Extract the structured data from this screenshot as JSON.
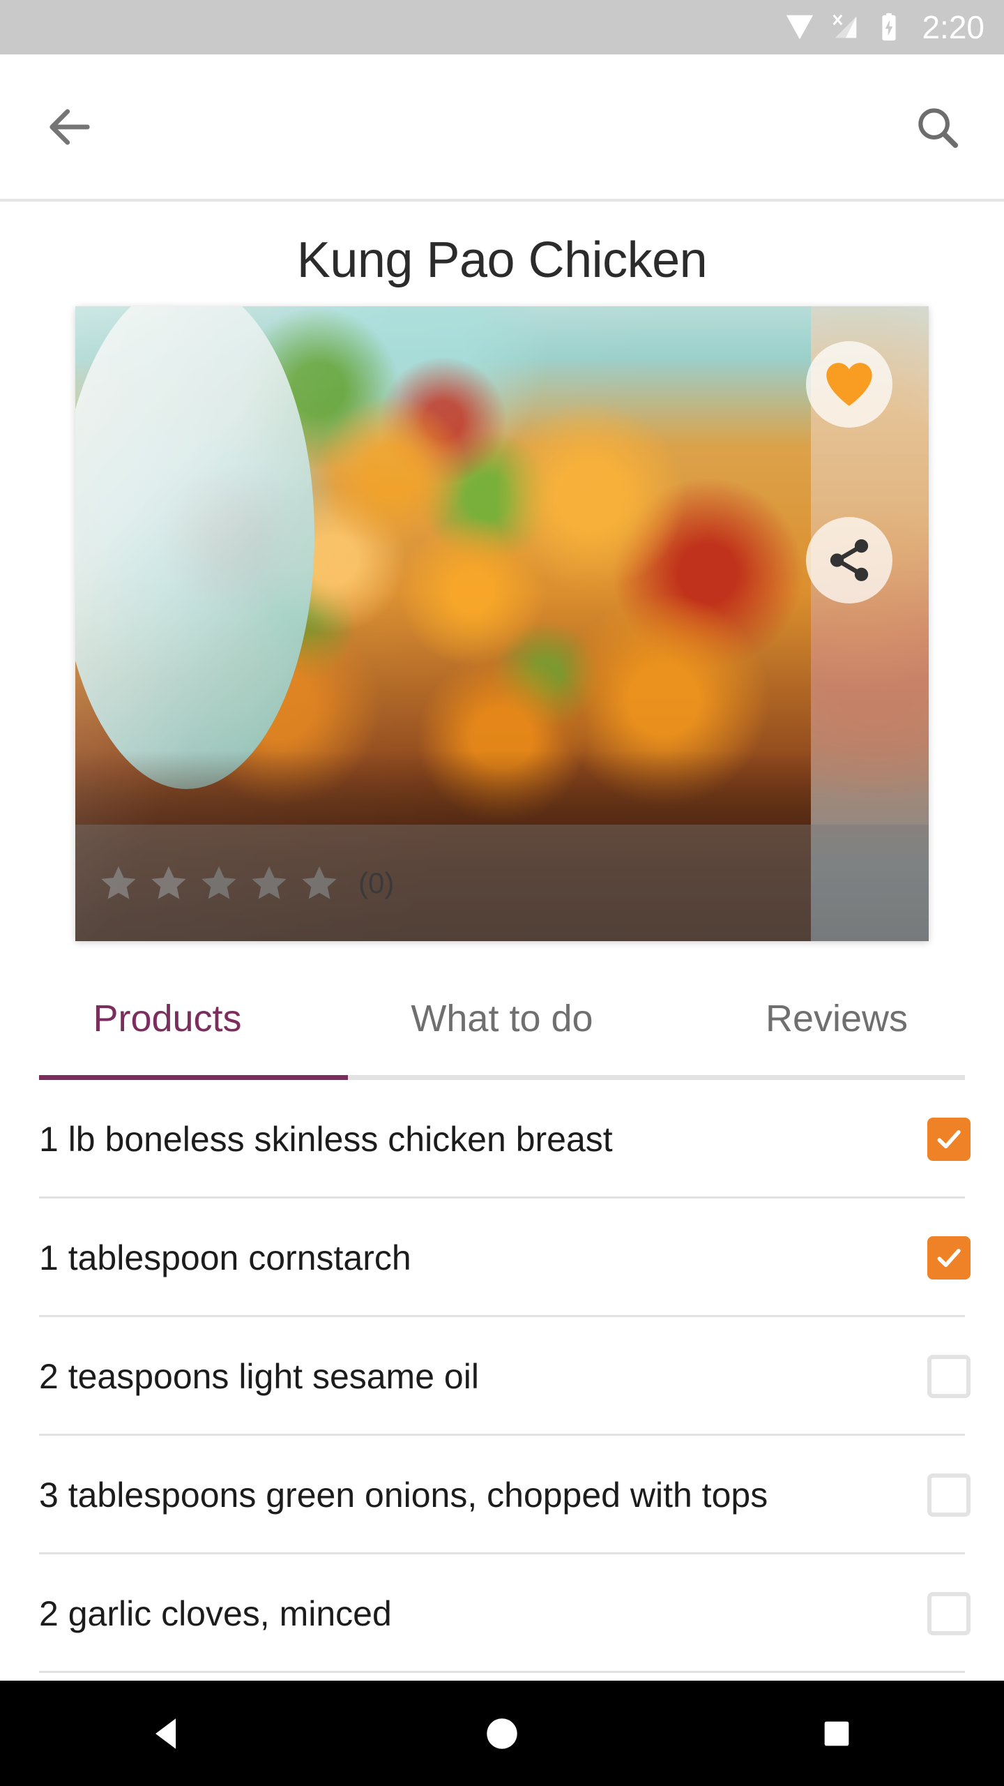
{
  "status_bar": {
    "time": "2:20",
    "icons": [
      "wifi-icon",
      "cellular-signal-off-icon",
      "battery-charging-icon"
    ],
    "background_color": "#c9c9c9",
    "foreground_color": "#ffffff"
  },
  "app_bar": {
    "back_label": "back-arrow",
    "search_label": "search",
    "background_color": "#ffffff",
    "icon_color": "#757575"
  },
  "recipe": {
    "title": "Kung Pao Chicken",
    "favorite_active": true,
    "favorite_color": "#f89d22",
    "share_color": "#333333",
    "rating": {
      "value": 0,
      "max": 5,
      "count_label": "(0)",
      "star_color": "#7d7d7d",
      "filled": 0
    }
  },
  "tabs": {
    "active_index": 0,
    "active_color": "#7b2d5e",
    "inactive_color": "#6f6f6f",
    "items": [
      {
        "label": "Products"
      },
      {
        "label": "What to do"
      },
      {
        "label": "Reviews"
      }
    ]
  },
  "ingredients": {
    "checked_color": "#ef8226",
    "unchecked_border_color": "#e3e3e3",
    "items": [
      {
        "text": "1 lb boneless skinless chicken breast",
        "checked": true
      },
      {
        "text": "1 tablespoon cornstarch",
        "checked": true
      },
      {
        "text": "2 teaspoons light sesame oil",
        "checked": false
      },
      {
        "text": "3 tablespoons green onions, chopped with tops",
        "checked": false
      },
      {
        "text": "2 garlic cloves, minced",
        "checked": false
      }
    ]
  },
  "nav_bar": {
    "background_color": "#000000",
    "icon_color": "#ffffff",
    "buttons": [
      {
        "name": "back"
      },
      {
        "name": "home"
      },
      {
        "name": "recents"
      }
    ]
  }
}
